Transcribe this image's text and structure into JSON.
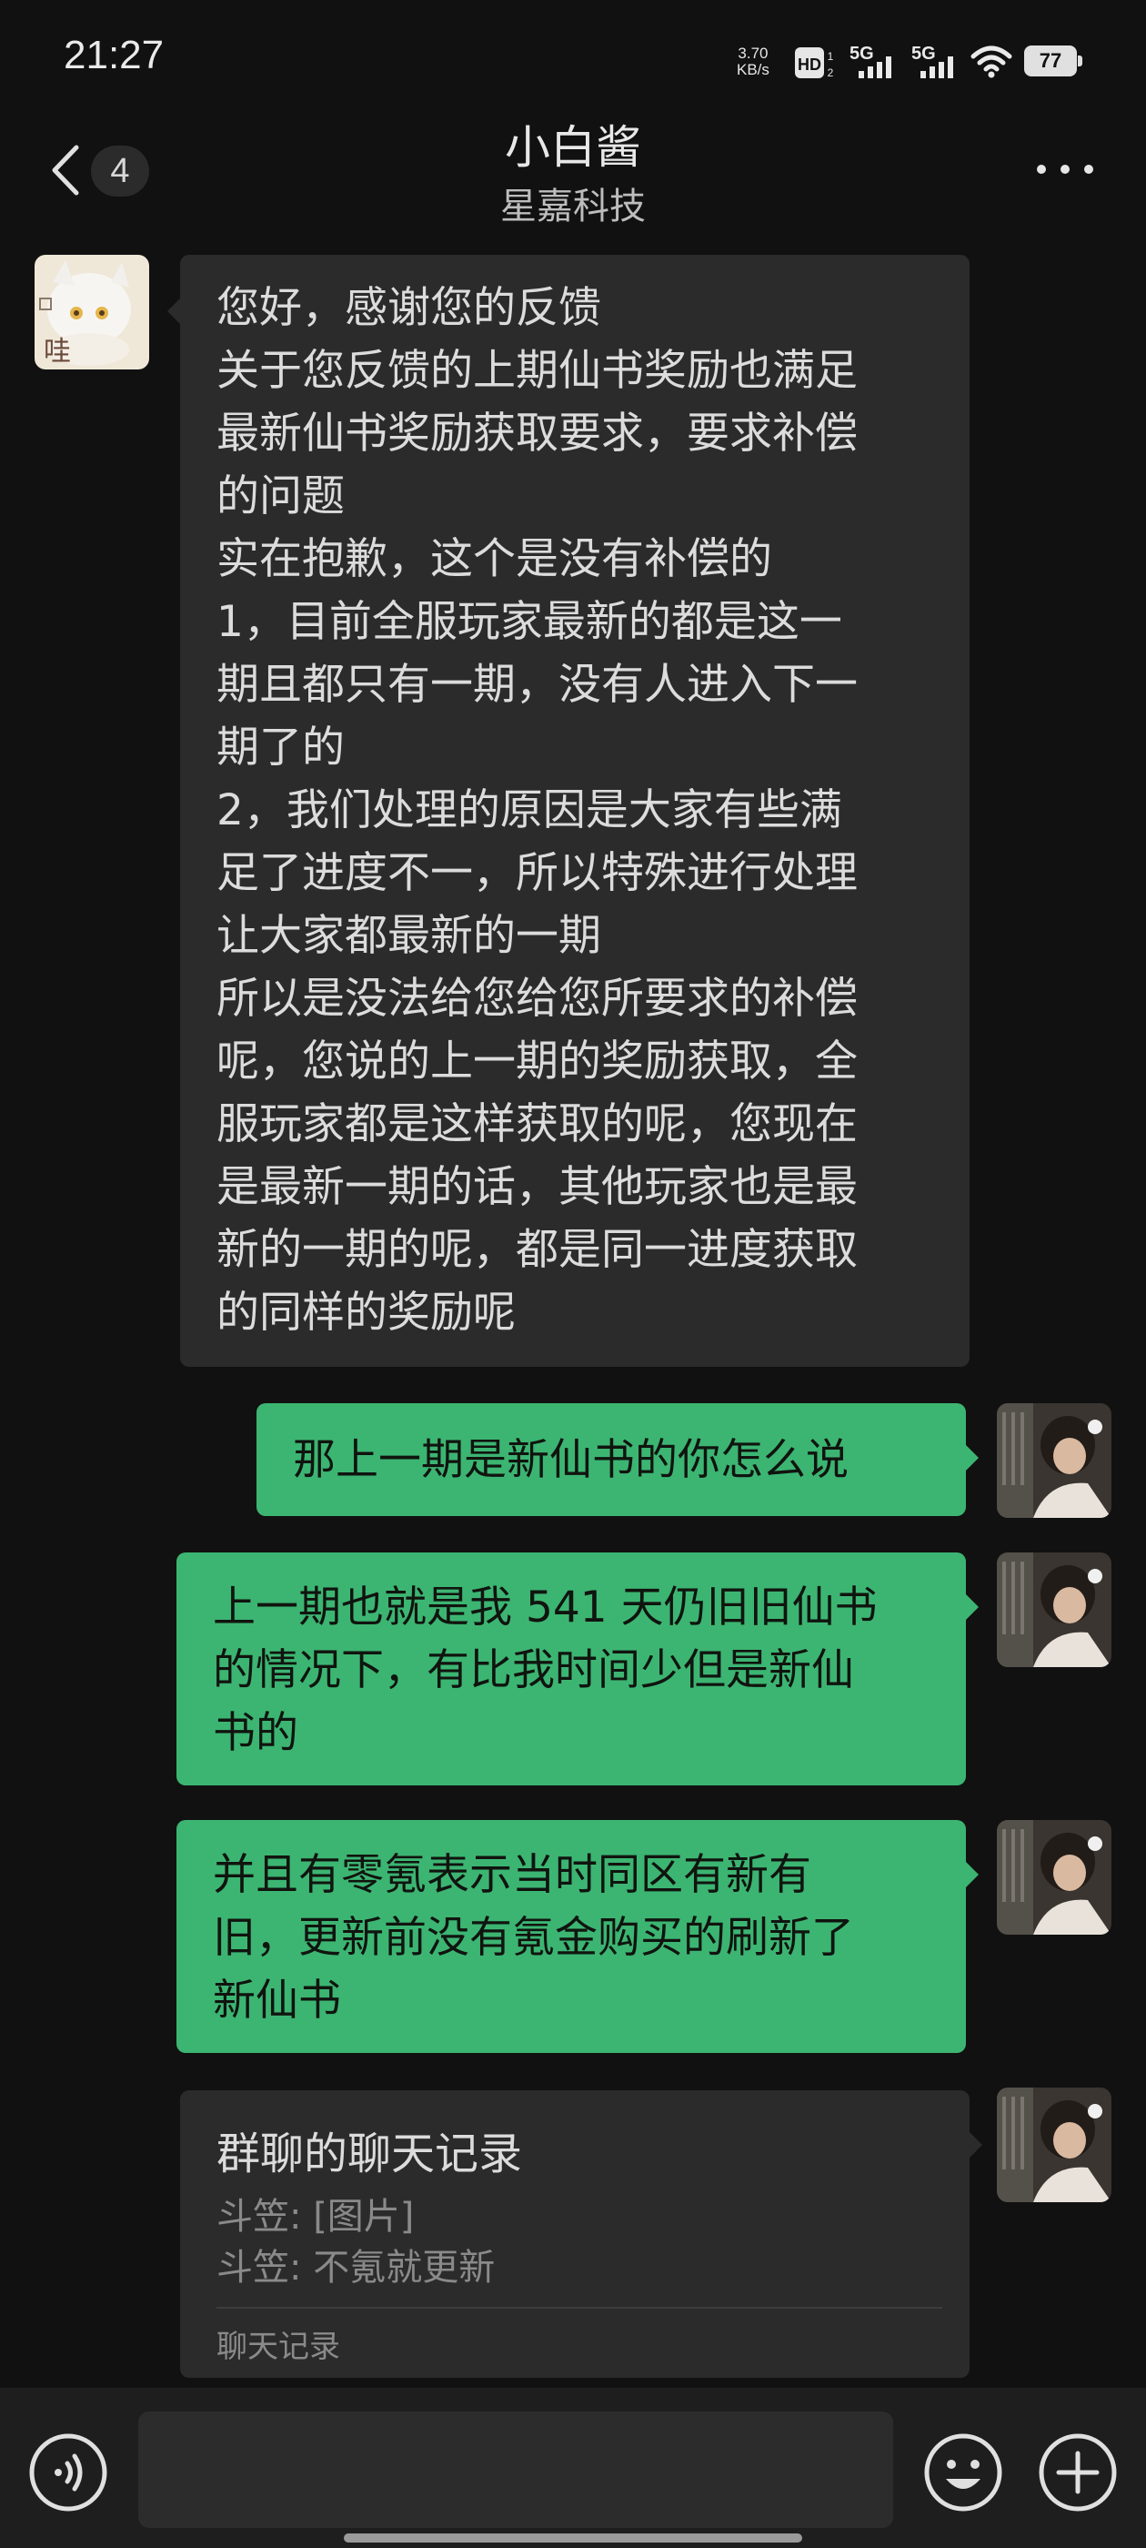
{
  "status_bar": {
    "time": "21:27",
    "net_speed_value": "3.70",
    "net_speed_unit": "KB/s",
    "hd_label": "HD",
    "sim1_label": "5G",
    "sim2_label": "5G",
    "battery": "77"
  },
  "header": {
    "unread_count": "4",
    "title": "小白酱",
    "subtitle": "星嘉科技"
  },
  "messages": [
    {
      "sender": "contact",
      "lines": [
        "您好，感谢您的反馈",
        "关于您反馈的上期仙书奖励也满足",
        "最新仙书奖励获取要求，要求补偿",
        "的问题",
        "实在抱歉，这个是没有补偿的",
        "1，目前全服玩家最新的都是这一",
        "期且都只有一期，没有人进入下一",
        "期了的",
        "2，我们处理的原因是大家有些满",
        "足了进度不一，所以特殊进行处理",
        "让大家都最新的一期",
        "所以是没法给您给您所要求的补偿",
        "呢，您说的上一期的奖励获取，全",
        "服玩家都是这样获取的呢，您现在",
        "是最新一期的话，其他玩家也是最",
        "新的一期的呢，都是同一进度获取",
        "的同样的奖励呢"
      ]
    },
    {
      "sender": "me",
      "lines": [
        "那上一期是新仙书的你怎么说"
      ]
    },
    {
      "sender": "me",
      "lines": [
        "上一期也就是我 541 天仍旧旧仙书",
        "的情况下，有比我时间少但是新仙",
        "书的"
      ]
    },
    {
      "sender": "me",
      "lines": [
        "并且有零氪表示当时同区有新有",
        "旧，更新前没有氪金购买的刷新了",
        "新仙书"
      ]
    }
  ],
  "chat_record": {
    "title": "群聊的聊天记录",
    "lines": [
      "斗笠: [图片]",
      "斗笠: 不氪就更新"
    ],
    "footer": "聊天记录"
  },
  "colors": {
    "background": "#111111",
    "incoming_bubble": "#2b2b2b",
    "outgoing_bubble": "#3cb572"
  },
  "icons": {
    "back": "chevron-left-icon",
    "more": "more-dots-icon",
    "voice": "voice-icon",
    "emoji": "emoji-icon",
    "add": "plus-icon"
  }
}
